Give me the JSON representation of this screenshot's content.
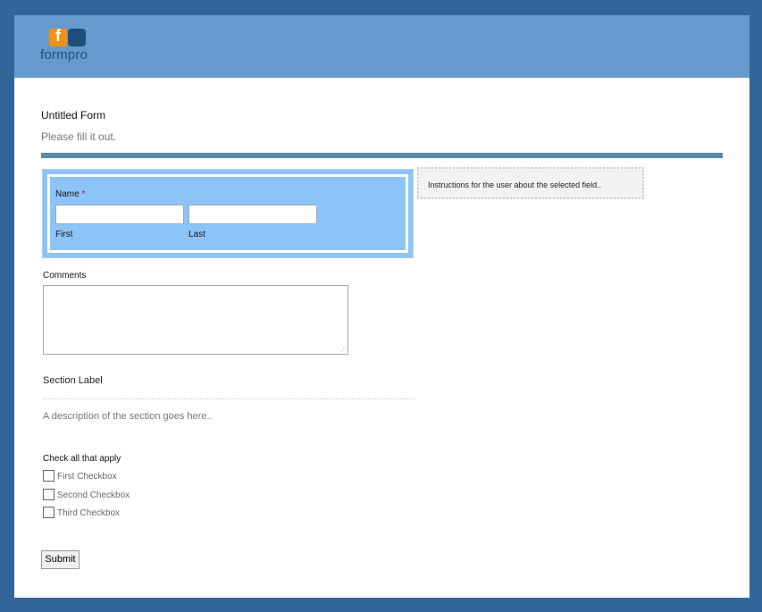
{
  "brand": {
    "logo_letter": "f",
    "logo_text": "formpro"
  },
  "form": {
    "title": "Untitled Form",
    "description": "Please fill it out."
  },
  "name_field": {
    "label": "Name",
    "required_mark": "*",
    "first_label": "First",
    "last_label": "Last",
    "first_value": "",
    "last_value": ""
  },
  "instructions": {
    "text": "Instructions for the user about the selected field.."
  },
  "comments": {
    "label": "Comments",
    "value": ""
  },
  "section": {
    "label": "Section Label",
    "description": "A description of the section goes here.."
  },
  "checkboxes": {
    "label": "Check all that apply",
    "items": [
      {
        "label": "First Checkbox",
        "checked": false
      },
      {
        "label": "Second Checkbox",
        "checked": false
      },
      {
        "label": "Third Checkbox",
        "checked": false
      }
    ]
  },
  "submit": {
    "label": "Submit"
  },
  "colors": {
    "page_bg": "#336699",
    "header_bg": "#6699cc",
    "selected_field_bg": "#8cc4f8",
    "rule": "#5b8aa8",
    "logo_orange": "#f29111",
    "logo_navy": "#1d4f7a"
  }
}
